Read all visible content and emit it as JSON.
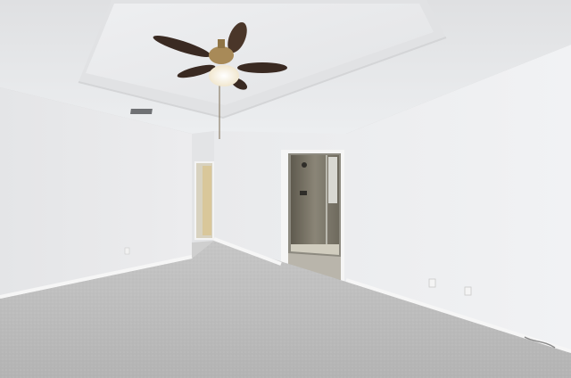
{
  "scene": {
    "kind": "empty bedroom interior",
    "objects": [
      "tray-ceiling",
      "ceiling-fan",
      "light-fixture",
      "air-vent",
      "bathroom-doorway",
      "glass-shower",
      "hallway-door",
      "carpet-floor",
      "baseboard",
      "wall-outlet"
    ]
  },
  "colors": {
    "wall_left": "#e6e7e9",
    "wall_right": "#eeeff1",
    "ceiling": "#e9eaec",
    "carpet": "#bdbdbd",
    "baseboard": "#f4f4f4",
    "fan_blade": "#3a2a22",
    "fan_brass": "#a88a58",
    "shower_tile": "#7a7668",
    "hall_light": "#d9c79a"
  }
}
